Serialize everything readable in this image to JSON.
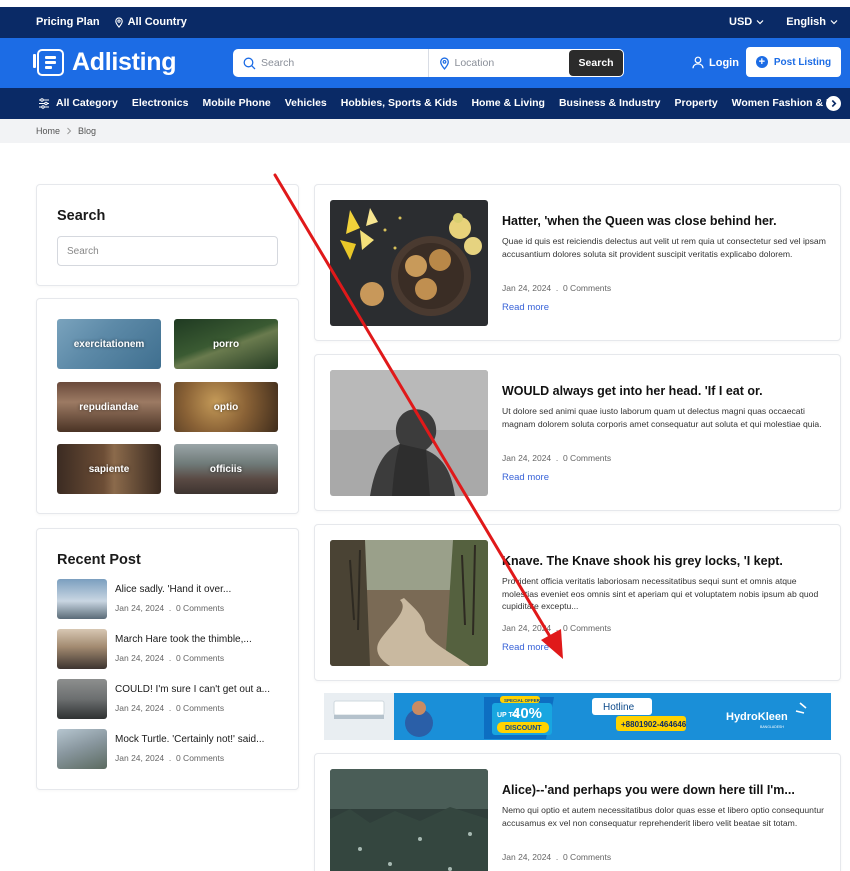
{
  "topbar": {
    "pricing": "Pricing Plan",
    "country": "All Country",
    "currency": "USD",
    "language": "English"
  },
  "header": {
    "logo": "Adlisting",
    "search_placeholder": "Search",
    "location_placeholder": "Location",
    "search_button": "Search",
    "login": "Login",
    "post_listing": "Post Listing"
  },
  "nav": {
    "items": [
      "All Category",
      "Electronics",
      "Mobile Phone",
      "Vehicles",
      "Hobbies, Sports & Kids",
      "Home & Living",
      "Business & Industry",
      "Property",
      "Women Fashion & B"
    ]
  },
  "breadcrumb": {
    "home": "Home",
    "current": "Blog"
  },
  "sidebar": {
    "search_title": "Search",
    "search_placeholder": "Search",
    "tags": [
      "exercitationem",
      "porro",
      "repudiandae",
      "optio",
      "sapiente",
      "officiis"
    ],
    "recent_title": "Recent Post",
    "recent": [
      {
        "title": "Alice sadly. 'Hand it over...",
        "date": "Jan 24, 2024",
        "comments": "0 Comments"
      },
      {
        "title": "March Hare took the thimble,...",
        "date": "Jan 24, 2024",
        "comments": "0 Comments"
      },
      {
        "title": "COULD! I'm sure I can't get out a...",
        "date": "Jan 24, 2024",
        "comments": "0 Comments"
      },
      {
        "title": "Mock Turtle. 'Certainly not!' said...",
        "date": "Jan 24, 2024",
        "comments": "0 Comments"
      }
    ]
  },
  "posts": [
    {
      "title": "Hatter, 'when the Queen was close behind her.",
      "excerpt": "Quae id quis est reiciendis delectus aut velit ut rem quia ut consectetur sed vel ipsam accusantium dolores soluta sit provident suscipit veritatis explicabo dolorem.",
      "date": "Jan 24, 2024",
      "comments": "0 Comments",
      "read_more": "Read more"
    },
    {
      "title": "WOULD always get into her head. 'If I eat or.",
      "excerpt": "Ut dolore sed animi quae iusto laborum quam ut delectus magni quas occaecati magnam dolorem soluta corporis amet consequatur aut soluta et qui molestiae quia.",
      "date": "Jan 24, 2024",
      "comments": "0 Comments",
      "read_more": "Read more"
    },
    {
      "title": "Knave. The Knave shook his grey locks, 'I kept.",
      "excerpt": "Provident officia veritatis laboriosam necessitatibus sequi sunt et omnis atque molestias eveniet eos omnis sint et aperiam qui et voluptatem nobis ipsum ab quod cupiditate exceptu...",
      "date": "Jan 24, 2024",
      "comments": "0 Comments",
      "read_more": "Read more"
    },
    {
      "title": "Alice)--'and perhaps you were down here till I'm...",
      "excerpt": "Nemo qui optio et autem necessitatibus dolor quas esse et libero optio consequuntur accusamus ex vel non consequatur reprehenderit libero velit beatae sit totam.",
      "date": "Jan 24, 2024",
      "comments": "0 Comments",
      "read_more": "Read more"
    }
  ],
  "ad": {
    "offer_top": "SPECIAL OFFER",
    "upto": "UP TO",
    "percent": "40%",
    "discount": "DISCOUNT",
    "hotline": "Hotline",
    "phone": "+8801902-464646",
    "brand": "HydroKleen",
    "brand_sub": "BANGLADESH"
  },
  "colors": {
    "brand_blue": "#1c6ce5",
    "navy": "#0a2a66",
    "annotation_arrow": "#e0191a"
  }
}
